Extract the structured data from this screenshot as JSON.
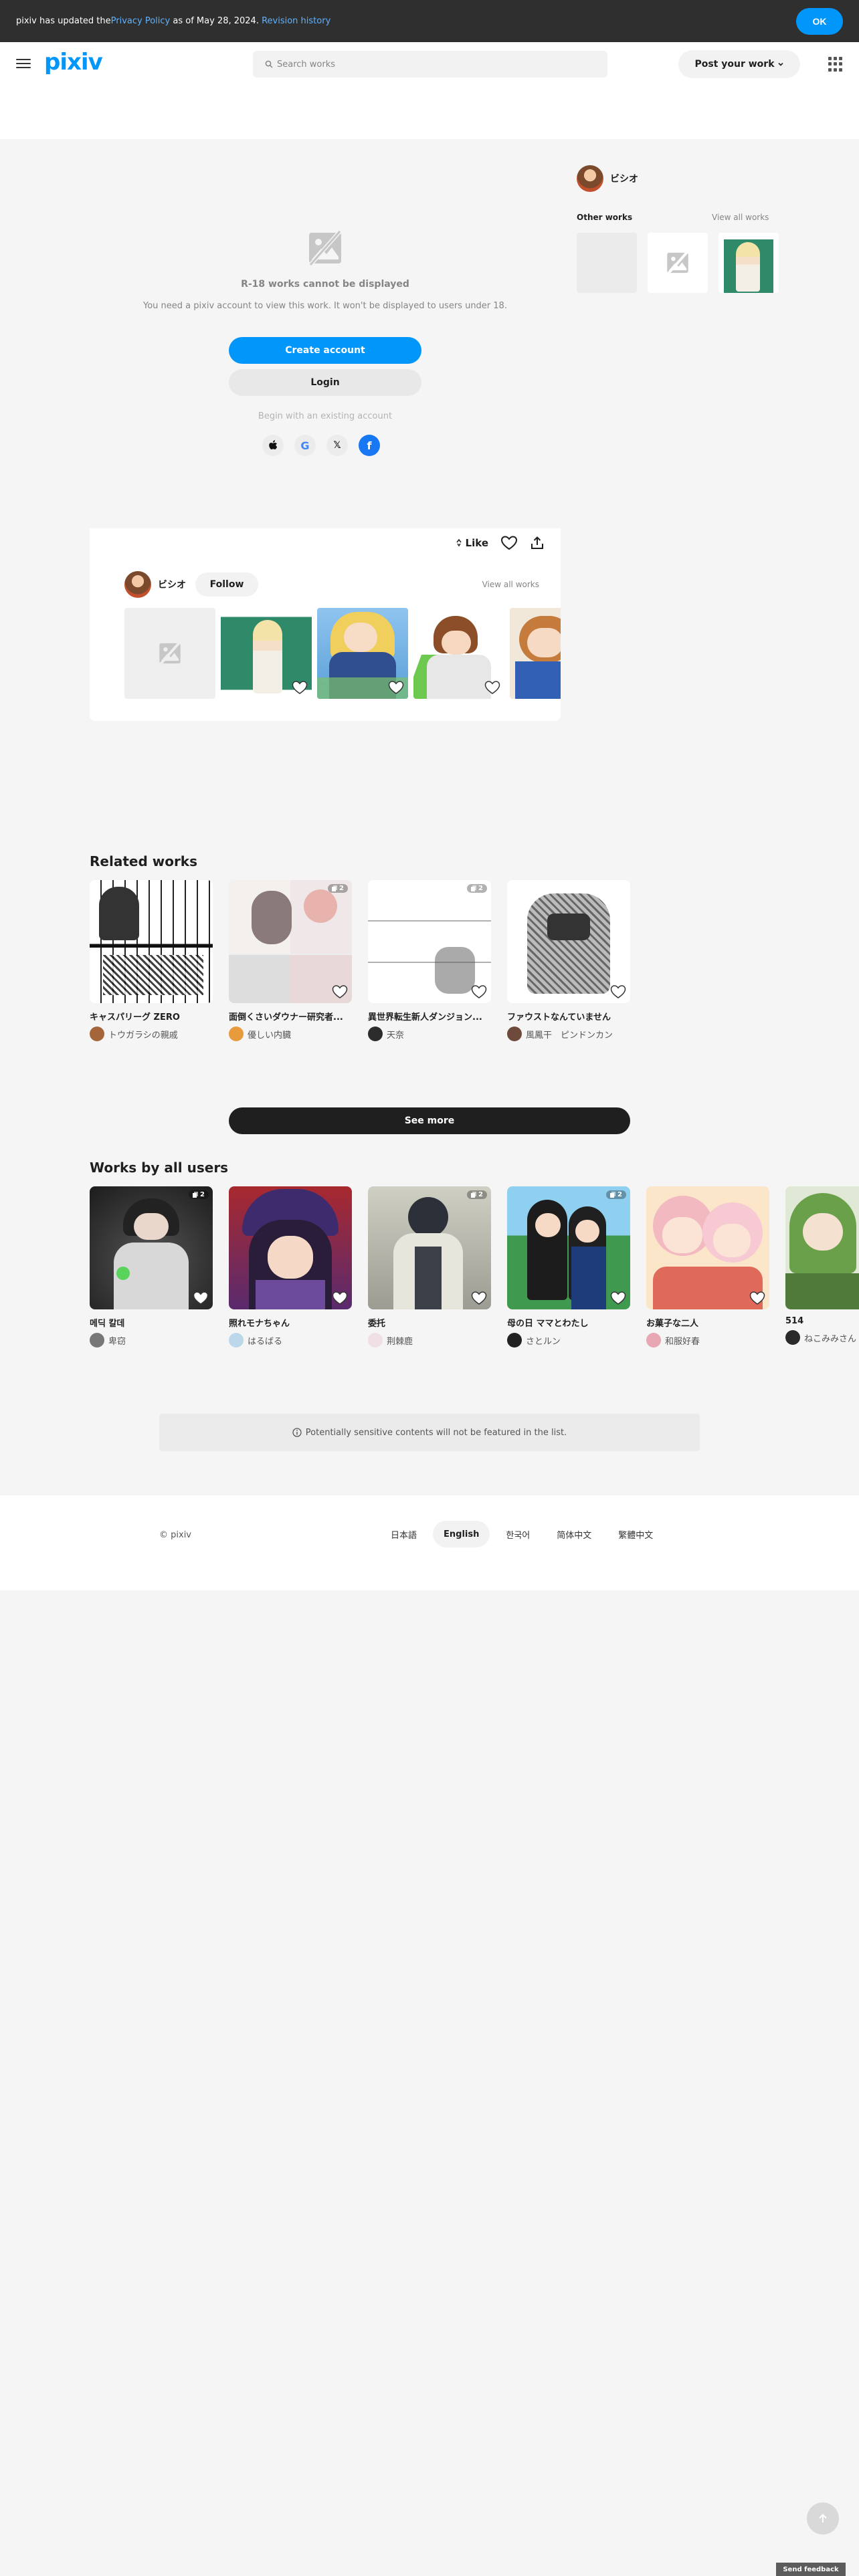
{
  "notice": {
    "prefix": "pixiv has updated the ",
    "policy_link": "Privacy Policy",
    "middle": " as of May 28, 2024. ",
    "history_link": "Revision history",
    "ok_label": "OK"
  },
  "header": {
    "logo": "pixiv",
    "search_placeholder": "Search works",
    "post_label": "Post your work"
  },
  "lock": {
    "title": "R-18 works cannot be displayed",
    "subtitle": "You need a pixiv account to view this work. It won't be displayed to users under 18.",
    "create_label": "Create account",
    "login_label": "Login",
    "begin_text": "Begin with an existing account",
    "socials": [
      {
        "name": "apple",
        "glyph": ""
      },
      {
        "name": "google",
        "glyph": "G"
      },
      {
        "name": "x",
        "glyph": "𝕏"
      },
      {
        "name": "facebook",
        "glyph": "f"
      }
    ]
  },
  "actions": {
    "like_label": "Like"
  },
  "author": {
    "name": "ビシオ",
    "follow_label": "Follow",
    "view_all": "View all works"
  },
  "sidebar": {
    "author_name": "ビシオ",
    "other_works": "Other works",
    "view_all": "View all works"
  },
  "related": {
    "title": "Related works",
    "items": [
      {
        "title": "キャスパリーグ ZERO",
        "user": "トウガラシの親戚",
        "pages": ""
      },
      {
        "title": "面倒くさいダウナー研究者...",
        "user": "優しい内臓",
        "pages": "2"
      },
      {
        "title": "異世界転生新人ダンジョン...",
        "user": "天奈",
        "pages": "2"
      },
      {
        "title": "ファウストなんていません",
        "user": "風鳳干　ピンドンカン",
        "pages": ""
      }
    ],
    "see_more": "See more"
  },
  "all_users": {
    "title": "Works by all users",
    "items": [
      {
        "title": "메딕 칼데",
        "user": "卑窃",
        "pages": "2"
      },
      {
        "title": "照れモナちゃん",
        "user": "はるばる",
        "pages": ""
      },
      {
        "title": "委托",
        "user": "荆棘鹿",
        "pages": "2"
      },
      {
        "title": "母の日 ママとわたし",
        "user": "さとルン",
        "pages": "2"
      },
      {
        "title": "お菓子な二人",
        "user": "和服好春",
        "pages": ""
      },
      {
        "title": "514",
        "user": "ねこみみさん",
        "pages": ""
      }
    ]
  },
  "sensitive_note": "Potentially sensitive contents will not be featured in the list.",
  "footer": {
    "copyright": "© pixiv",
    "languages": [
      "日本語",
      "English",
      "한국어",
      "简体中文",
      "繁體中文"
    ],
    "active_language": "English"
  },
  "feedback_label": "Send feedback",
  "colors": {
    "accent": "#0096fa",
    "dark": "#1f1f1f",
    "notice_bg": "#2f2f2f"
  }
}
